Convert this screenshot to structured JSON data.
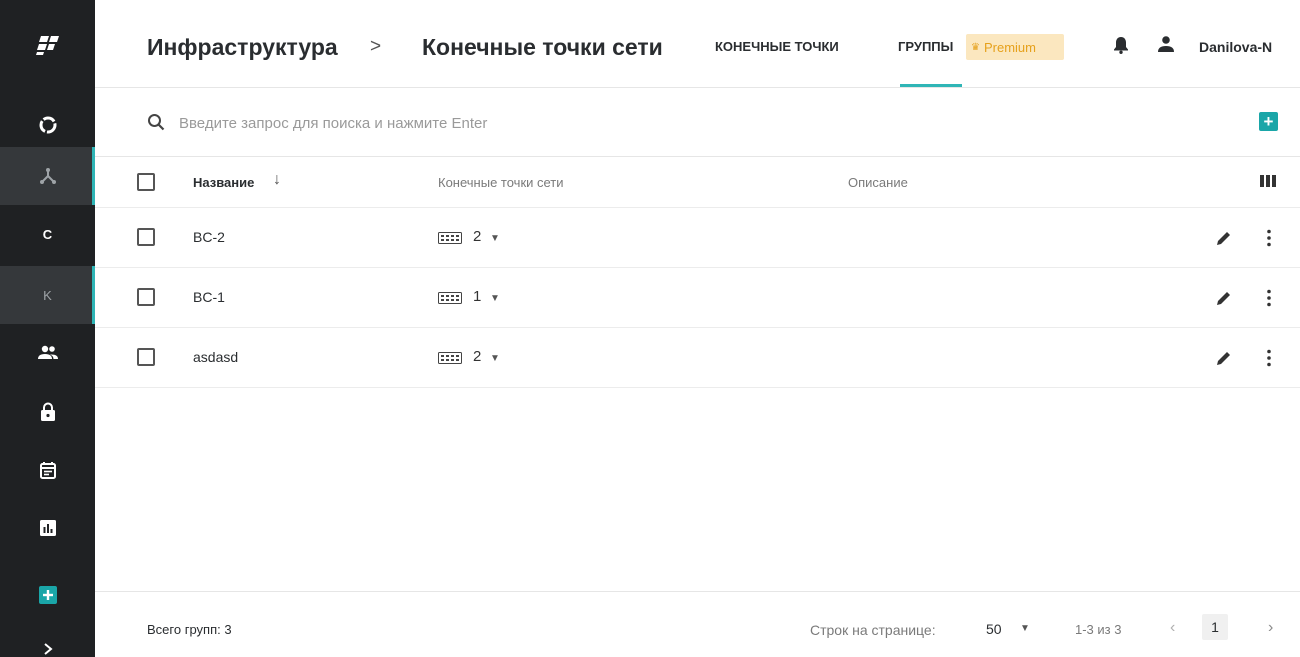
{
  "sidebar": {
    "logo_icon": "brand-logo-icon",
    "items": [
      {
        "icon": "dashboard-ring-icon"
      },
      {
        "icon": "network-topology-icon",
        "active": true
      },
      {
        "letter": "C"
      },
      {
        "letter": "K",
        "active": true
      },
      {
        "icon": "users-icon"
      },
      {
        "icon": "lock-icon"
      },
      {
        "icon": "calendar-icon"
      },
      {
        "icon": "chart-icon"
      },
      {
        "icon": "add-icon"
      },
      {
        "icon": "chevron-right-icon"
      }
    ]
  },
  "header": {
    "breadcrumb_root": "Инфраструктура",
    "breadcrumb_separator": ">",
    "breadcrumb_current": "Конечные точки сети",
    "tabs": [
      {
        "label": "КОНЕЧНЫЕ ТОЧКИ"
      },
      {
        "label": "ГРУППЫ",
        "active": true
      }
    ],
    "premium_badge": "Premium",
    "username": "Danilova-N"
  },
  "search": {
    "placeholder": "Введите запрос для поиска и нажмите Enter",
    "value": ""
  },
  "table": {
    "columns": {
      "name": "Название",
      "endpoints": "Конечные точки сети",
      "description": "Описание"
    },
    "rows": [
      {
        "name": "BC-2",
        "endpoints": "2",
        "description": ""
      },
      {
        "name": "BC-1",
        "endpoints": "1",
        "description": ""
      },
      {
        "name": "asdasd",
        "endpoints": "2",
        "description": ""
      }
    ]
  },
  "footer": {
    "total": "Всего групп: 3",
    "rows_per_page_label": "Строк на странице:",
    "rows_per_page_value": "50",
    "range": "1-3 из 3",
    "current_page": "1"
  },
  "colors": {
    "sidebar_bg": "#1f2123",
    "accent": "#2fb5b6",
    "premium_bg": "#fbe7bf",
    "premium_text": "#e6a11c"
  }
}
